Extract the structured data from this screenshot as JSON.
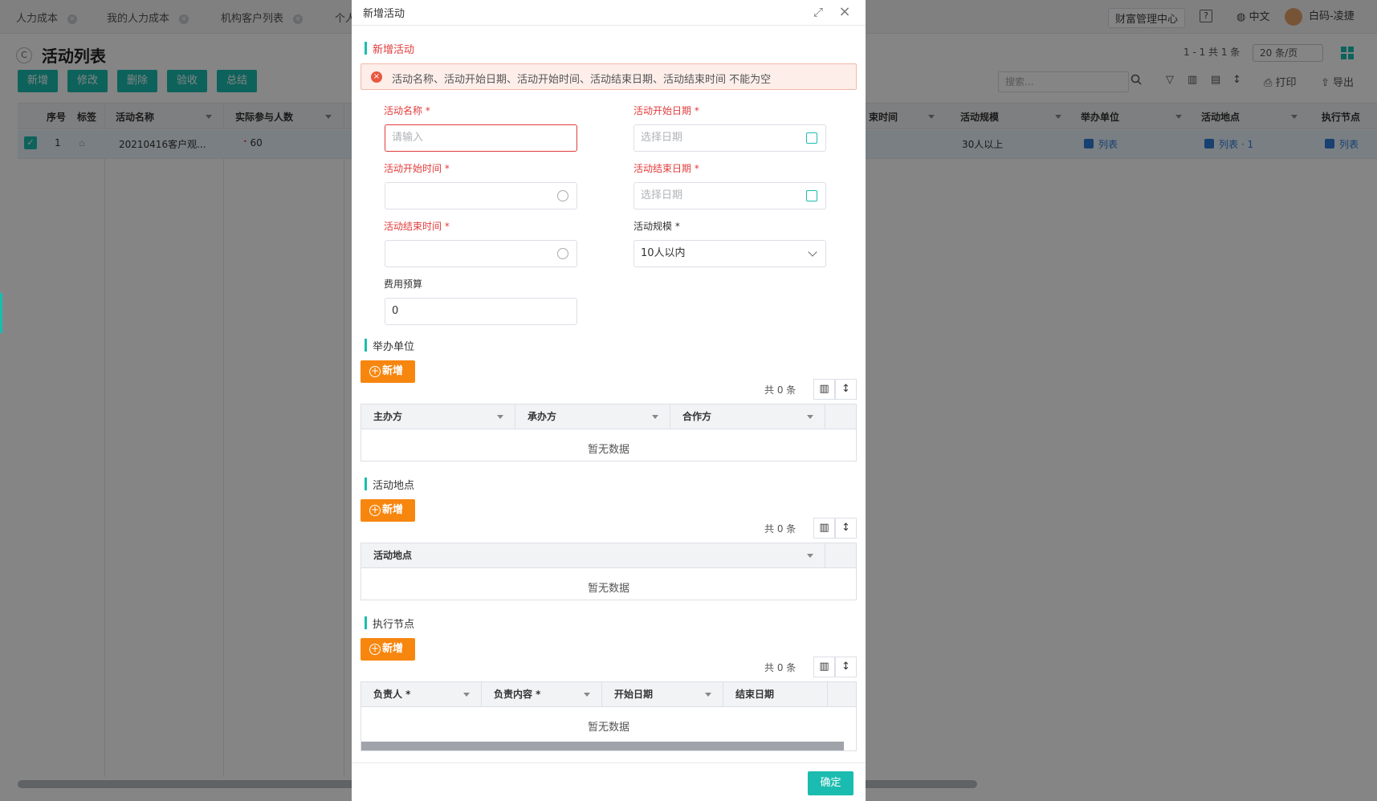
{
  "tabs": [
    {
      "label": "人力成本"
    },
    {
      "label": "我的人力成本"
    },
    {
      "label": "机构客户列表"
    },
    {
      "label": "个人"
    }
  ],
  "top_right": {
    "center": "财富管理中心",
    "help": "?",
    "language": "中文",
    "user": "白码-凌捷"
  },
  "page": {
    "title": "活动列表",
    "toolbar": [
      "新增",
      "修改",
      "删除",
      "验收",
      "总结"
    ],
    "pager_text": "1 - 1  共  1  条",
    "page_size": "20 条/页",
    "search_placeholder": "搜索...",
    "print": "打印",
    "export": "导出",
    "columns": [
      "序号",
      "标签",
      "活动名称",
      "实际参与人数",
      "束时间",
      "活动规模",
      "举办单位",
      "活动地点",
      "执行节点"
    ],
    "row": {
      "index": "1",
      "name": "20210416客户观...",
      "participants": "60",
      "scale": "30人以上",
      "host": "列表",
      "location": "列表 · 1",
      "node": "列表"
    }
  },
  "modal": {
    "title": "新增活动",
    "section_main": "新增活动",
    "alert": "活动名称、活动开始日期、活动开始时间、活动结束日期、活动结束时间 不能为空",
    "fields": {
      "name_label": "活动名称 *",
      "name_placeholder": "请输入",
      "start_date_label": "活动开始日期 *",
      "start_date_placeholder": "选择日期",
      "start_time_label": "活动开始时间 *",
      "end_date_label": "活动结束日期 *",
      "end_date_placeholder": "选择日期",
      "end_time_label": "活动结束时间 *",
      "scale_label": "活动规模 *",
      "scale_value": "10人以内",
      "budget_label": "费用预算",
      "budget_value": "0"
    },
    "host_section": {
      "title": "举办单位",
      "add": "新增",
      "count": "共  0  条",
      "columns": [
        "主办方",
        "承办方",
        "合作方"
      ],
      "empty": "暂无数据"
    },
    "location_section": {
      "title": "活动地点",
      "add": "新增",
      "count": "共  0  条",
      "columns": [
        "活动地点"
      ],
      "empty": "暂无数据"
    },
    "node_section": {
      "title": "执行节点",
      "add": "新增",
      "count": "共  0  条",
      "columns": [
        "负责人 *",
        "负责内容 *",
        "开始日期",
        "结束日期"
      ],
      "empty": "暂无数据"
    },
    "confirm": "确定"
  },
  "colors": {
    "accent": "#1bbcb0",
    "add_button": "#f7860f",
    "error": "#e23b3b",
    "link": "#2f7bd8"
  }
}
